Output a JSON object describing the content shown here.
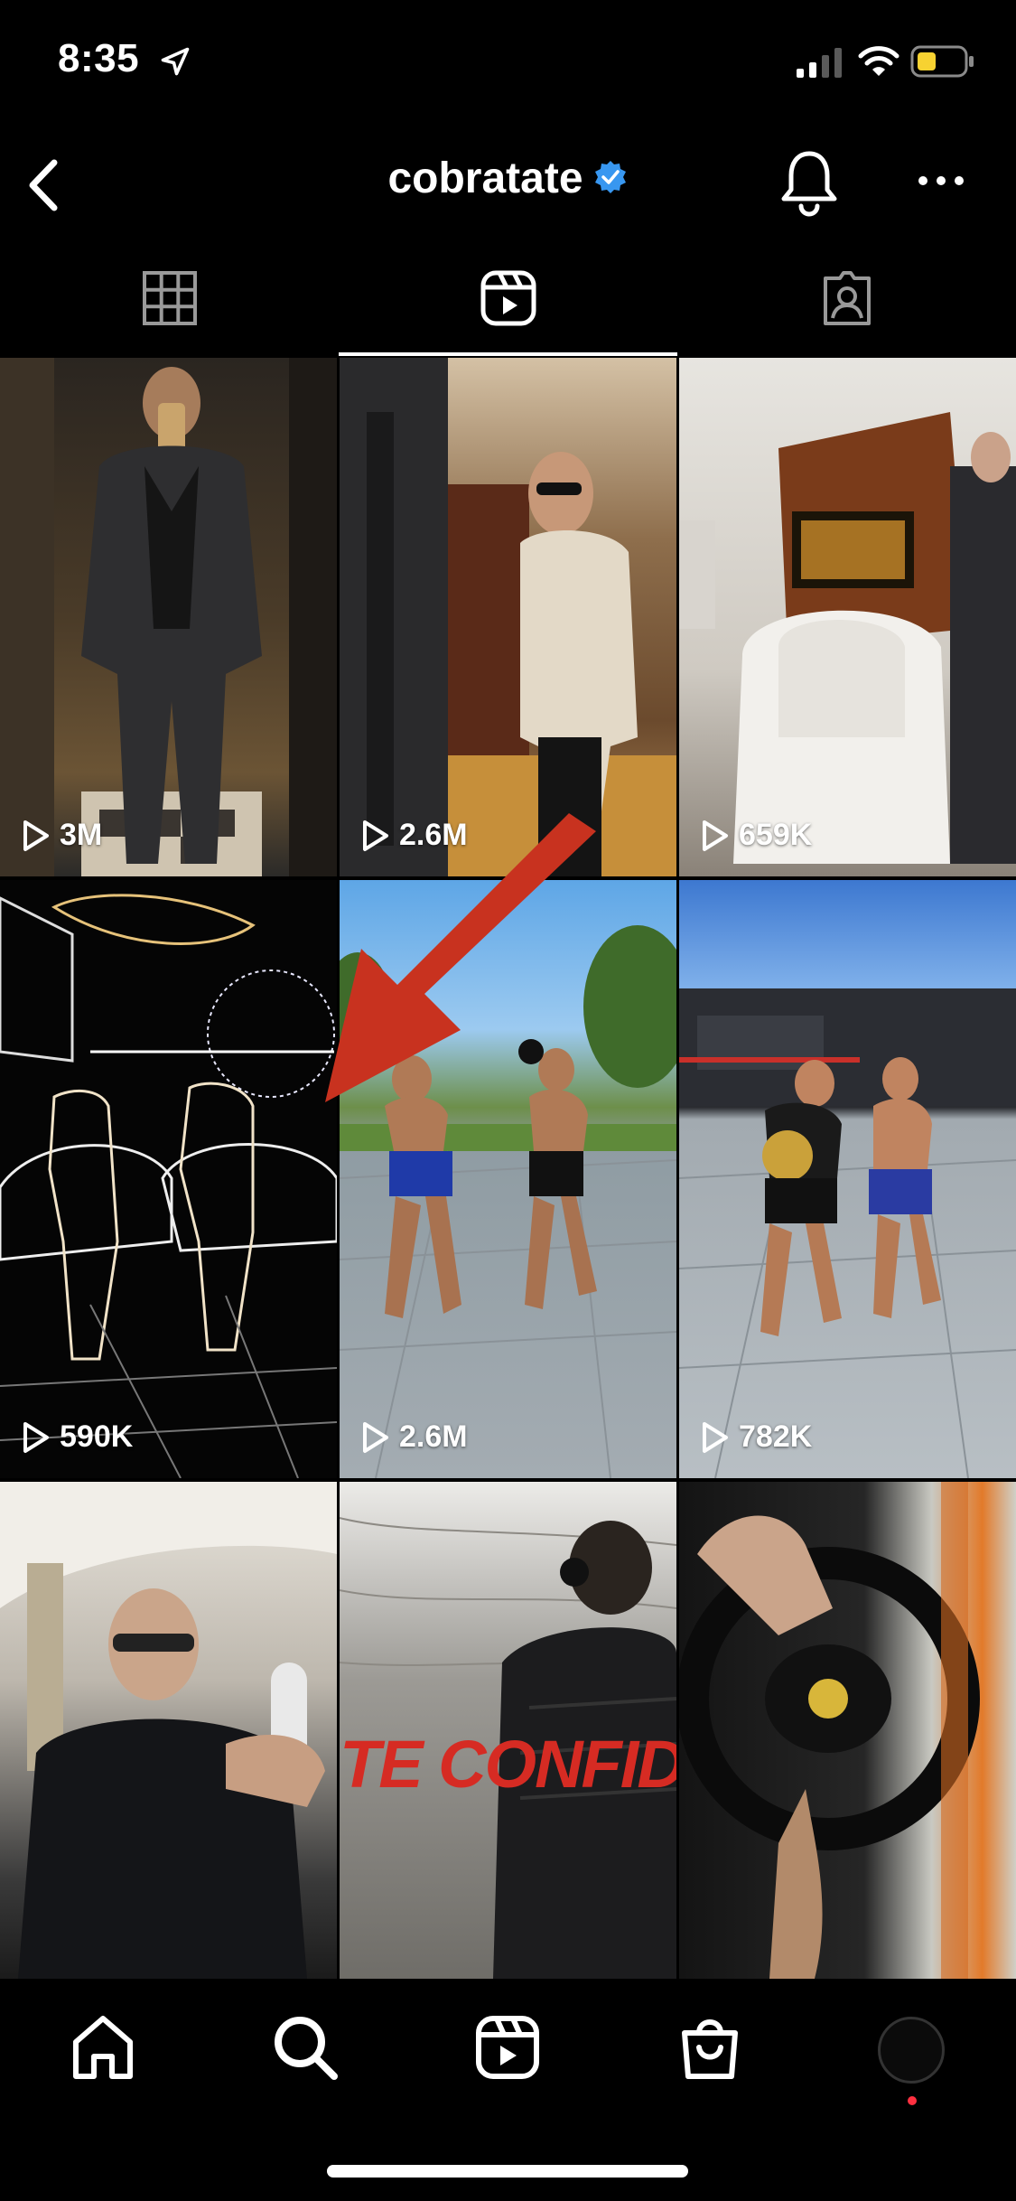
{
  "status_bar": {
    "time": "8:35"
  },
  "header": {
    "username": "cobratate"
  },
  "tabs": [
    {
      "name": "posts-grid",
      "icon": "grid-icon"
    },
    {
      "name": "reels",
      "icon": "reels-icon",
      "selected": true
    },
    {
      "name": "tagged",
      "icon": "tagged-icon"
    }
  ],
  "reels": [
    {
      "views": "3M",
      "scene": "mirror-selfie-elevator"
    },
    {
      "views": "2.6M",
      "scene": "man-in-hallway"
    },
    {
      "views": "659K",
      "scene": "private-jet-interior"
    },
    {
      "views": "590K",
      "scene": "neon-outline-sparring"
    },
    {
      "views": "2.6M",
      "scene": "boxing-pads-outdoor"
    },
    {
      "views": "782K",
      "scene": "kickboxing-training"
    },
    {
      "views": "",
      "scene": "man-in-jet-seat"
    },
    {
      "views": "",
      "scene": "confidential-video"
    },
    {
      "views": "",
      "scene": "car-steering-wheel"
    }
  ],
  "overlay": {
    "annotation": "red-arrow-pointing-to-reel"
  },
  "overlay_text": {
    "confidential": "TE CONFIDEN"
  },
  "bottom_nav": [
    {
      "name": "home",
      "icon": "home-icon"
    },
    {
      "name": "search",
      "icon": "search-icon"
    },
    {
      "name": "reels",
      "icon": "reels-icon"
    },
    {
      "name": "shop",
      "icon": "shop-bag-icon"
    },
    {
      "name": "profile",
      "icon": "avatar"
    }
  ],
  "colors": {
    "accent_verified": "#3897f0",
    "notification_dot": "#ff3040",
    "arrow": "#c8321f"
  }
}
